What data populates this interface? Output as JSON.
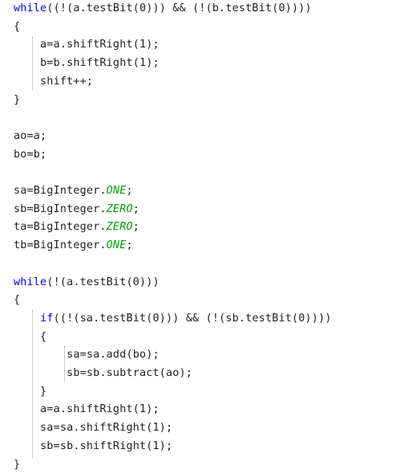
{
  "lines": [
    [
      {
        "t": "while",
        "k": "kw"
      },
      {
        "t": "((!(a.testBit(0))) && (!(b.testBit(0))))",
        "k": "plain"
      }
    ],
    [
      {
        "t": "{",
        "k": "plain"
      }
    ],
    [
      {
        "t": "    a=a.shiftRight(1);",
        "k": "plain"
      }
    ],
    [
      {
        "t": "    b=b.shiftRight(1);",
        "k": "plain"
      }
    ],
    [
      {
        "t": "    shift++;",
        "k": "plain"
      }
    ],
    [
      {
        "t": "}",
        "k": "plain"
      }
    ],
    [],
    [
      {
        "t": "ao=a;",
        "k": "plain"
      }
    ],
    [
      {
        "t": "bo=b;",
        "k": "plain"
      }
    ],
    [],
    [
      {
        "t": "sa=BigInteger.",
        "k": "plain"
      },
      {
        "t": "ONE",
        "k": "const"
      },
      {
        "t": ";",
        "k": "plain"
      }
    ],
    [
      {
        "t": "sb=BigInteger.",
        "k": "plain"
      },
      {
        "t": "ZERO",
        "k": "const"
      },
      {
        "t": ";",
        "k": "plain"
      }
    ],
    [
      {
        "t": "ta=BigInteger.",
        "k": "plain"
      },
      {
        "t": "ZERO",
        "k": "const"
      },
      {
        "t": ";",
        "k": "plain"
      }
    ],
    [
      {
        "t": "tb=BigInteger.",
        "k": "plain"
      },
      {
        "t": "ONE",
        "k": "const"
      },
      {
        "t": ";",
        "k": "plain"
      }
    ],
    [],
    [
      {
        "t": "while",
        "k": "kw"
      },
      {
        "t": "(!(a.testBit(0)))",
        "k": "plain"
      }
    ],
    [
      {
        "t": "{",
        "k": "plain"
      }
    ],
    [
      {
        "t": "    ",
        "k": "plain"
      },
      {
        "t": "if",
        "k": "kw"
      },
      {
        "t": "((!(sa.testBit(0))) && (!(sb.testBit(0))))",
        "k": "plain"
      }
    ],
    [
      {
        "t": "    {",
        "k": "plain"
      }
    ],
    [
      {
        "t": "        sa=sa.add(bo);",
        "k": "plain"
      }
    ],
    [
      {
        "t": "        sb=sb.subtract(ao);",
        "k": "plain"
      }
    ],
    [
      {
        "t": "    }",
        "k": "plain"
      }
    ],
    [
      {
        "t": "    a=a.shiftRight(1);",
        "k": "plain"
      }
    ],
    [
      {
        "t": "    sa=sa.shiftRight(1);",
        "k": "plain"
      }
    ],
    [
      {
        "t": "    sb=sb.shiftRight(1);",
        "k": "plain"
      }
    ],
    [
      {
        "t": "}",
        "k": "plain"
      }
    ]
  ],
  "colors": {
    "keyword": "#0000ff",
    "constant": "#00a000",
    "text": "#1f1f1f",
    "guide": "#9a9a9a",
    "background": "#ffffff"
  }
}
